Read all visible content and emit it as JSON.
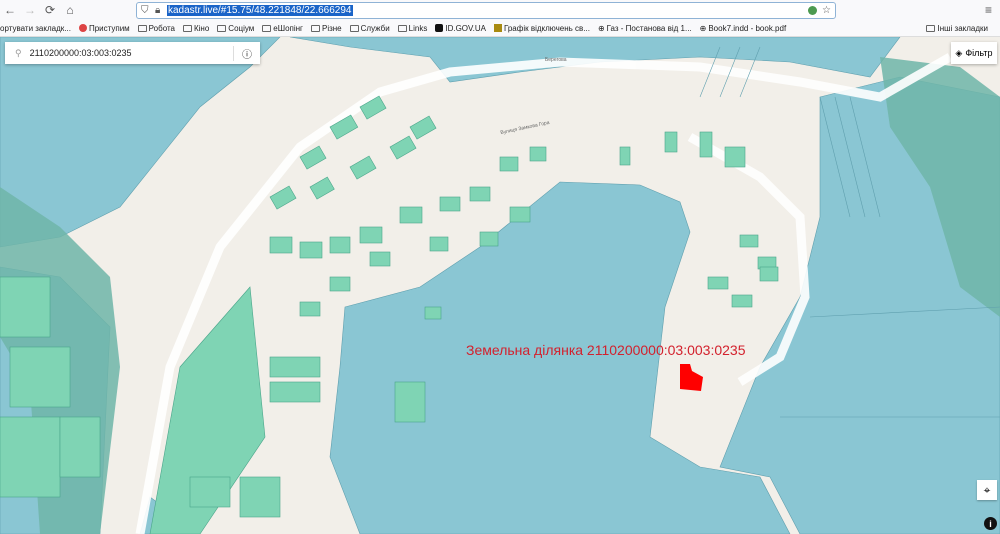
{
  "browser": {
    "url": "kadastr.live/#15.75/48.221848/22.666294",
    "icons": [
      "back-icon",
      "forward-icon",
      "reload-icon",
      "home-icon",
      "shield-icon",
      "lock-icon",
      "extension-icon",
      "star-icon",
      "menu-icon"
    ],
    "bookmarks": [
      {
        "label": "ортувати закладк...",
        "icon": "none"
      },
      {
        "label": "Приступим",
        "icon": "site-icon"
      },
      {
        "label": "Робота",
        "icon": "folder-icon"
      },
      {
        "label": "Кіно",
        "icon": "folder-icon"
      },
      {
        "label": "Соціум",
        "icon": "folder-icon"
      },
      {
        "label": "еШопінг",
        "icon": "folder-icon"
      },
      {
        "label": "Різне",
        "icon": "folder-icon"
      },
      {
        "label": "Служби",
        "icon": "folder-icon"
      },
      {
        "label": "Links",
        "icon": "folder-icon"
      },
      {
        "label": "ID.GOV.UA",
        "icon": "site-icon"
      },
      {
        "label": "Графік відключень св...",
        "icon": "site-icon"
      },
      {
        "label": "Газ - Постанова від 1...",
        "icon": "globe-icon"
      },
      {
        "label": "Book7.indd - book.pdf",
        "icon": "globe-icon"
      }
    ],
    "other_bookmarks": "Інші закладки"
  },
  "map": {
    "search_value": "2110200000:03:003:0235",
    "filter_label": "Фільтр",
    "annotation": "Земельна ділянка 2110200000:03:003:0235",
    "streets": [
      "Берегова",
      "Вулиця Замкова Гора"
    ],
    "colors": {
      "land": "#f2efe9",
      "water": "#8ac6d3",
      "parcel": "#7fd4b4",
      "forest": "#6fb5a8",
      "target": "#ff0000",
      "annotation": "#d3212d"
    }
  }
}
